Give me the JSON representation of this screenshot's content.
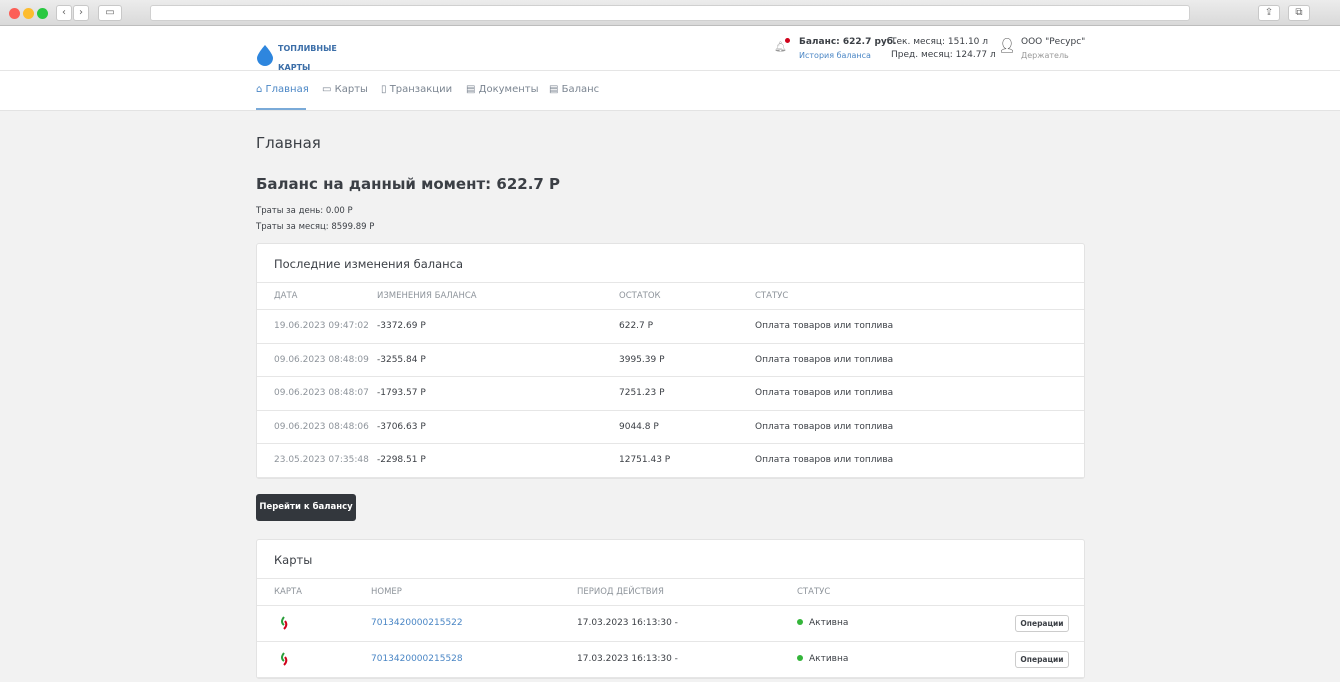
{
  "brand": {
    "line1": "ТОПЛИВНЫЕ",
    "line2": "КАРТЫ"
  },
  "header": {
    "balance": "Баланс: 622.7 руб.",
    "history_link": "История баланса",
    "current_month": "Тек. месяц: 151.10 л",
    "prev_month": "Пред. месяц: 124.77 л",
    "org": "ООО \"Ресурс\"",
    "role": "Держатель"
  },
  "nav": [
    "Главная",
    "Карты",
    "Транзакции",
    "Документы",
    "Баланс"
  ],
  "page_title": "Главная",
  "balance_heading": "Баланс на данный момент: 622.7 Р",
  "spend_day": "Траты за день: 0.00 Р",
  "spend_month": "Траты за месяц: 8599.89 Р",
  "changes": {
    "title": "Последние изменения баланса",
    "columns": [
      "ДАТА",
      "ИЗМЕНЕНИЯ БАЛАНСА",
      "ОСТАТОК",
      "СТАТУС"
    ],
    "rows": [
      [
        "19.06.2023 09:47:02",
        "-3372.69 Р",
        "622.7 Р",
        "Оплата товаров или топлива"
      ],
      [
        "09.06.2023 08:48:09",
        "-3255.84 Р",
        "3995.39 Р",
        "Оплата товаров или топлива"
      ],
      [
        "09.06.2023 08:48:07",
        "-1793.57 Р",
        "7251.23 Р",
        "Оплата товаров или топлива"
      ],
      [
        "09.06.2023 08:48:06",
        "-3706.63 Р",
        "9044.8 Р",
        "Оплата товаров или топлива"
      ],
      [
        "23.05.2023 07:35:48",
        "-2298.51 Р",
        "12751.43 Р",
        "Оплата товаров или топлива"
      ]
    ]
  },
  "goto_balance": "Перейти к балансу",
  "cards": {
    "title": "Карты",
    "columns": [
      "КАРТА",
      "НОМЕР",
      "ПЕРИОД ДЕЙСТВИЯ",
      "СТАТУС"
    ],
    "rows": [
      {
        "number": "7013420000215522",
        "period": "17.03.2023 16:13:30 -",
        "status": "Активна",
        "action": "Операции"
      },
      {
        "number": "7013420000215528",
        "period": "17.03.2023 16:13:30 -",
        "status": "Активна",
        "action": "Операции"
      }
    ]
  }
}
